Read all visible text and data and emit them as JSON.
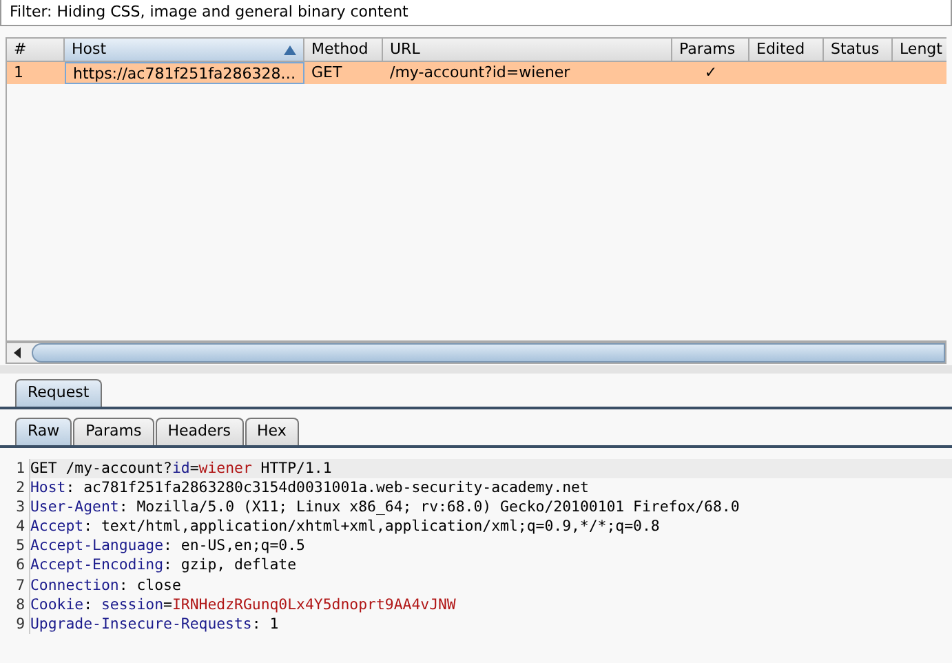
{
  "filter": "Filter: Hiding CSS, image and general binary content",
  "table": {
    "columns": [
      {
        "label": "#",
        "sorted": false
      },
      {
        "label": "Host",
        "sorted": true
      },
      {
        "label": "Method",
        "sorted": false
      },
      {
        "label": "URL",
        "sorted": false
      },
      {
        "label": "Params",
        "sorted": false
      },
      {
        "label": "Edited",
        "sorted": false
      },
      {
        "label": "Status",
        "sorted": false
      },
      {
        "label": "Lengt",
        "sorted": false
      }
    ],
    "rows": [
      {
        "selected": true,
        "cells": [
          "1",
          "https://ac781f251fa286328…",
          "GET",
          "/my-account?id=wiener",
          "✓",
          "",
          "",
          ""
        ]
      }
    ]
  },
  "panel_tabs": [
    {
      "label": "Request",
      "selected": true
    }
  ],
  "view_tabs": [
    {
      "label": "Raw",
      "selected": true
    },
    {
      "label": "Params",
      "selected": false
    },
    {
      "label": "Headers",
      "selected": false
    },
    {
      "label": "Hex",
      "selected": false
    }
  ],
  "request_lines": [
    {
      "number": "1",
      "segments": [
        {
          "kind": "text",
          "text": "GET /my-account?"
        },
        {
          "kind": "param-name",
          "text": "id"
        },
        {
          "kind": "text",
          "text": "="
        },
        {
          "kind": "param-value",
          "text": "wiener"
        },
        {
          "kind": "text",
          "text": " HTTP/1.1"
        }
      ]
    },
    {
      "number": "2",
      "segments": [
        {
          "kind": "header",
          "text": "Host"
        },
        {
          "kind": "text",
          "text": ": ac781f251fa2863280c3154d0031001a.web-security-academy.net"
        }
      ]
    },
    {
      "number": "3",
      "segments": [
        {
          "kind": "header",
          "text": "User-Agent"
        },
        {
          "kind": "text",
          "text": ": Mozilla/5.0 (X11; Linux x86_64; rv:68.0) Gecko/20100101 Firefox/68.0"
        }
      ]
    },
    {
      "number": "4",
      "segments": [
        {
          "kind": "header",
          "text": "Accept"
        },
        {
          "kind": "text",
          "text": ": text/html,application/xhtml+xml,application/xml;q=0.9,*/*;q=0.8"
        }
      ]
    },
    {
      "number": "5",
      "segments": [
        {
          "kind": "header",
          "text": "Accept-Language"
        },
        {
          "kind": "text",
          "text": ": en-US,en;q=0.5"
        }
      ]
    },
    {
      "number": "6",
      "segments": [
        {
          "kind": "header",
          "text": "Accept-Encoding"
        },
        {
          "kind": "text",
          "text": ": gzip, deflate"
        }
      ]
    },
    {
      "number": "7",
      "segments": [
        {
          "kind": "header",
          "text": "Connection"
        },
        {
          "kind": "text",
          "text": ": close"
        }
      ]
    },
    {
      "number": "8",
      "segments": [
        {
          "kind": "header",
          "text": "Cookie"
        },
        {
          "kind": "text",
          "text": ": "
        },
        {
          "kind": "param-name",
          "text": "session"
        },
        {
          "kind": "text",
          "text": "="
        },
        {
          "kind": "param-value",
          "text": "IRNHedzRGunq0Lx4Y5dnoprt9AA4vJNW"
        }
      ]
    },
    {
      "number": "9",
      "segments": [
        {
          "kind": "header",
          "text": "Upgrade-Insecure-Requests"
        },
        {
          "kind": "text",
          "text": ": 1"
        }
      ]
    }
  ]
}
